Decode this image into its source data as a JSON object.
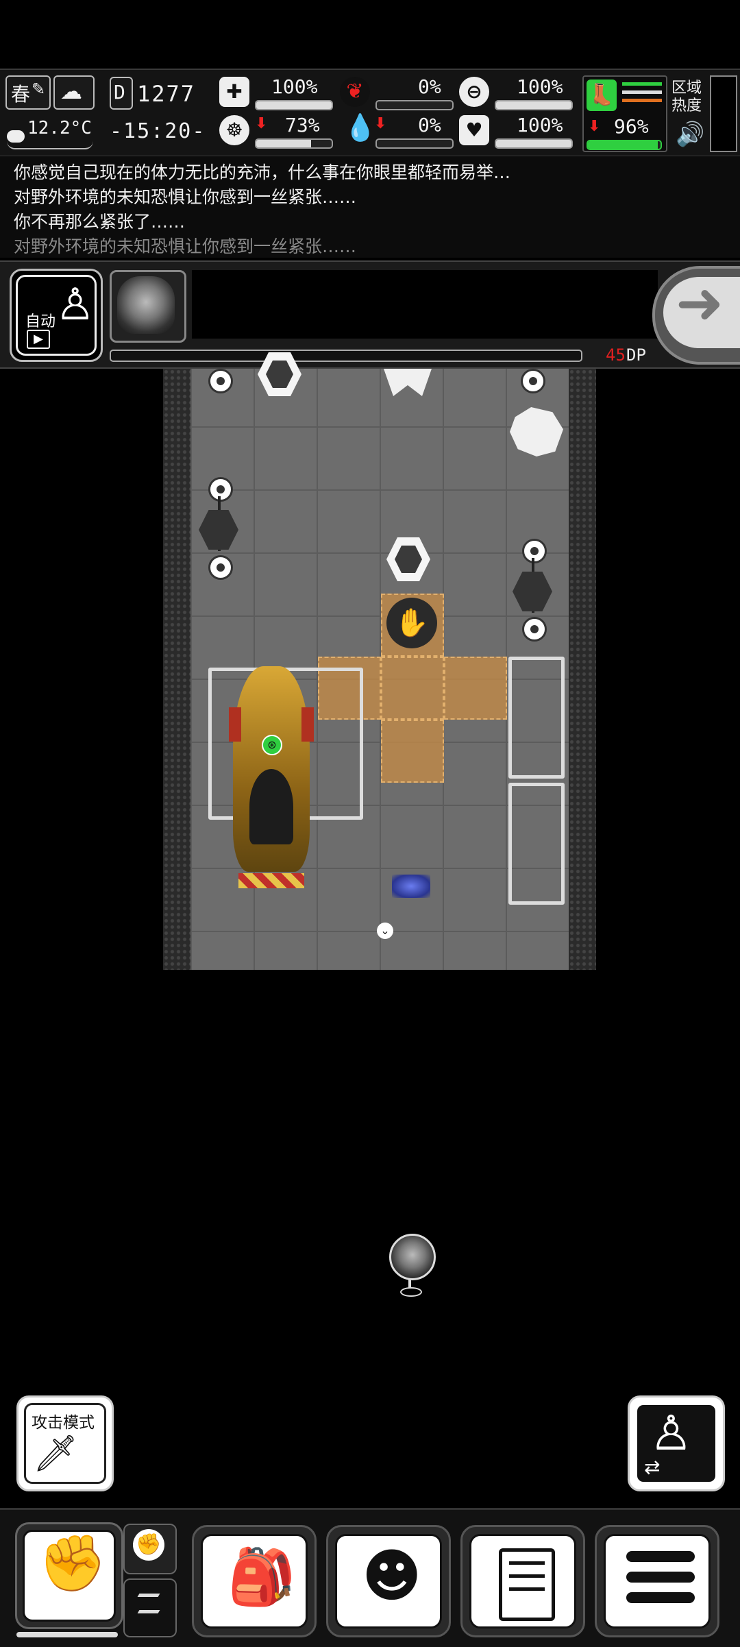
{
  "status": {
    "season": "春",
    "temperature": "12.2°C",
    "day": "1277",
    "day_prefix": "D",
    "time": "-15:20-",
    "health_pct": "100%",
    "stomach_pct": "0%",
    "stamina_pct": "100%",
    "sanity_pct": "73%",
    "blood_pct": "0%",
    "mood_pct": "100%",
    "leg_pct": "96%",
    "region_heat_label": "区域热度",
    "bars": {
      "health": 1.0,
      "stomach": 0.0,
      "stamina": 1.0,
      "sanity": 0.73,
      "blood": 0.0,
      "mood": 1.0,
      "leg": 0.96
    },
    "colors": {
      "alert": "#e02020",
      "leg_green": "#2fcf40",
      "leg_orange": "#e07020"
    }
  },
  "log": {
    "lines": [
      "你感觉自己现在的体力无比的充沛，什么事在你眼里都轻而易举…",
      "对野外环境的未知恐惧让你感到一丝紧张……",
      "你不再那么紧张了……",
      "对野外环境的未知恐惧让你感到一丝紧张……"
    ]
  },
  "actionbar": {
    "auto_label": "自动",
    "dp_value": "45",
    "dp_unit": "DP",
    "progress": 0.0
  },
  "controls": {
    "attack_mode_label": "攻击模式"
  },
  "icons": {
    "season": "feather-icon",
    "weather": "partly-cloudy-icon",
    "health": "medkit-icon",
    "stomach": "stomach-icon",
    "stamina": "capsule-icon",
    "sanity": "brain-icon",
    "blood": "blood-drop-icon",
    "mood": "heart-icon",
    "leg": "boot-icon",
    "sound": "speaker-icon",
    "next": "arrow-right-icon"
  }
}
